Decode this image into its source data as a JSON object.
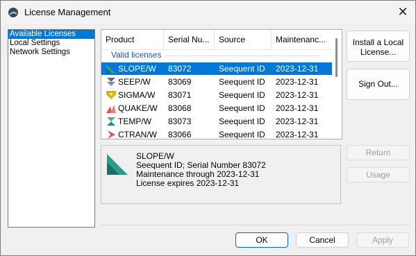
{
  "window": {
    "title": "License Management",
    "close_glyph": "✕"
  },
  "nav": {
    "items": [
      {
        "label": "Available Licenses",
        "selected": true
      },
      {
        "label": "Local Settings",
        "selected": false
      },
      {
        "label": "Network Settings",
        "selected": false
      }
    ]
  },
  "license_list": {
    "columns": [
      "Product",
      "Serial Nu...",
      "Source",
      "Maintenanc..."
    ],
    "group_label": "Valid licenses",
    "rows": [
      {
        "product": "SLOPE/W",
        "serial": "83072",
        "source": "Seequent ID",
        "maintenance": "2023-12-31",
        "icon": "slope-icon",
        "selected": true
      },
      {
        "product": "SEEP/W",
        "serial": "83069",
        "source": "Seequent ID",
        "maintenance": "2023-12-31",
        "icon": "seep-icon",
        "selected": false
      },
      {
        "product": "SIGMA/W",
        "serial": "83071",
        "source": "Seequent ID",
        "maintenance": "2023-12-31",
        "icon": "sigma-icon",
        "selected": false
      },
      {
        "product": "QUAKE/W",
        "serial": "83068",
        "source": "Seequent ID",
        "maintenance": "2023-12-31",
        "icon": "quake-icon",
        "selected": false
      },
      {
        "product": "TEMP/W",
        "serial": "83073",
        "source": "Seequent ID",
        "maintenance": "2023-12-31",
        "icon": "temp-icon",
        "selected": false
      },
      {
        "product": "CTRAN/W",
        "serial": "83066",
        "source": "Seequent ID",
        "maintenance": "2023-12-31",
        "icon": "ctran-icon",
        "selected": false
      }
    ]
  },
  "details": {
    "icon": "slope-icon",
    "lines": [
      "SLOPE/W",
      "Seequent ID; Serial Number 83072",
      "Maintenance through 2023-12-31",
      "License expires 2023-12-31"
    ]
  },
  "buttons": {
    "install": "Install a Local License...",
    "sign_out": "Sign Out...",
    "return": "Return",
    "usage": "Usage",
    "ok": "OK",
    "cancel": "Cancel",
    "apply": "Apply"
  },
  "colors": {
    "selection": "#0078d7",
    "group_header": "#1c5aa8",
    "slope": "#2a9d8f",
    "seep": "#5b6b80",
    "sigma": "#e2b100",
    "quake": "#d9534f",
    "temp": "#3bb3a0",
    "ctran": "#d9534f"
  }
}
